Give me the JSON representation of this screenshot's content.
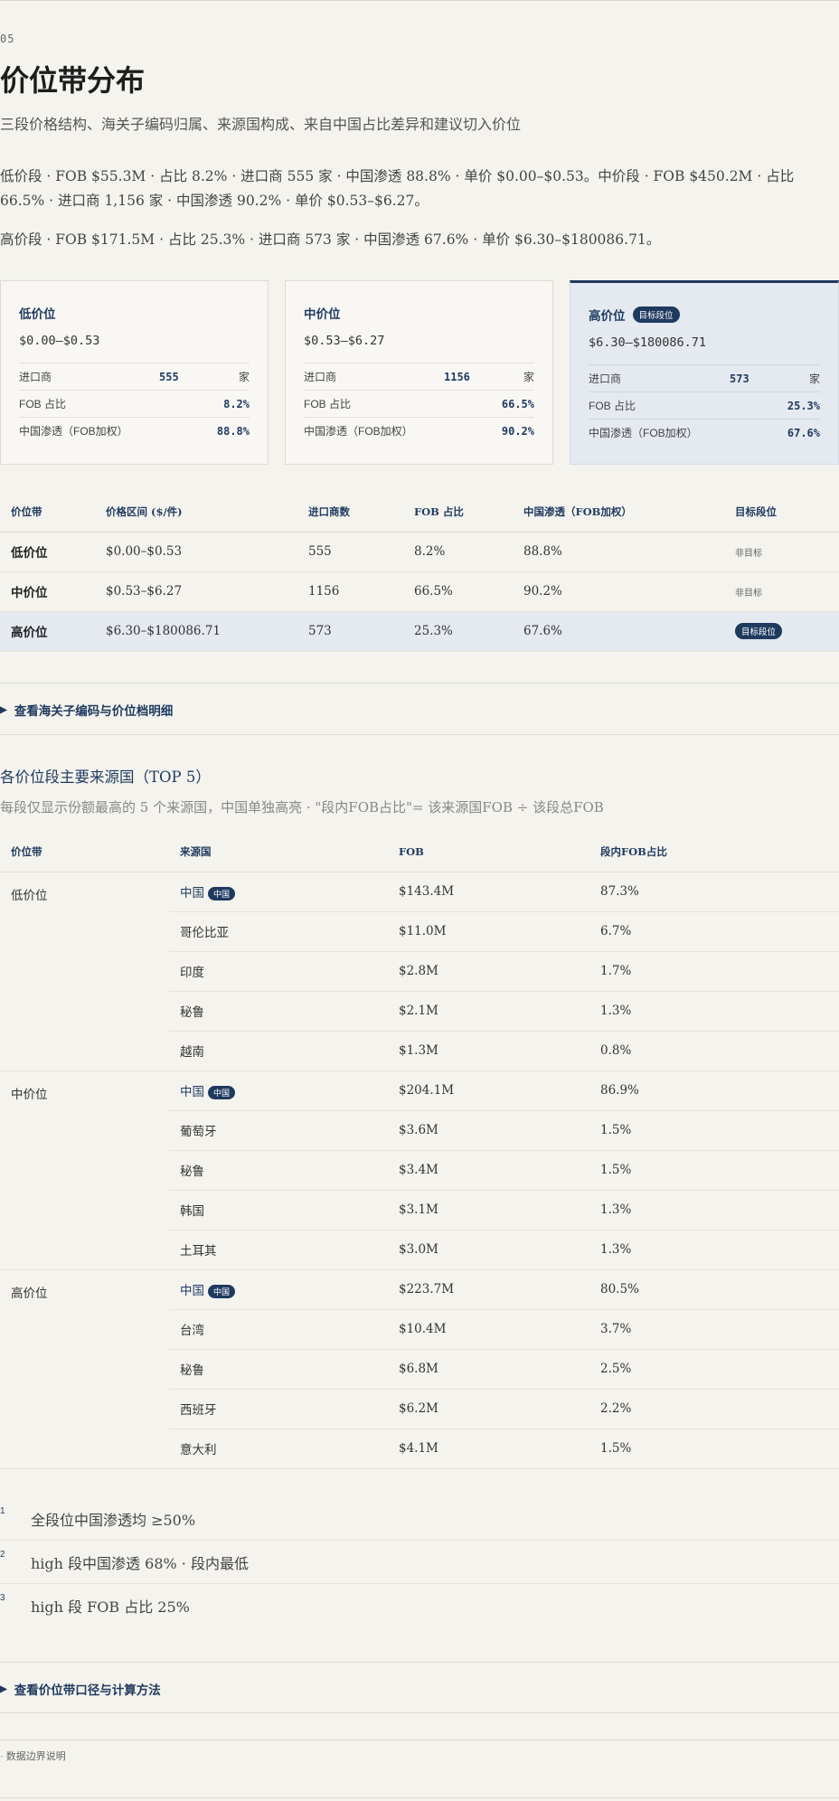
{
  "section_number": "05",
  "title": "价位带分布",
  "subtitle": "三段价格结构、海关子编码归属、来源国构成、来自中国占比差异和建议切入价位",
  "summary": {
    "line1": "低价段 · FOB $55.3M · 占比 8.2% · 进口商 555 家 · 中国渗透 88.8% · 单价 $0.00–$0.53。中价段 · FOB $450.2M · 占比 66.5% · 进口商 1,156 家 · 中国渗透 90.2% · 单价 $0.53–$6.27。",
    "line2": "高价段 · FOB $171.5M · 占比 25.3% · 进口商 573 家 · 中国渗透 67.6% · 单价 $6.30–$180086.71。"
  },
  "cards": [
    {
      "title": "低价位",
      "badge": "",
      "range": "$0.00–$0.53",
      "importers_label": "进口商",
      "importers": "555",
      "unit": "家",
      "fob_label": "FOB 占比",
      "fob": "8.2%",
      "cn_label": "中国渗透（FOB加权）",
      "cn": "88.8%"
    },
    {
      "title": "中价位",
      "badge": "",
      "range": "$0.53–$6.27",
      "importers_label": "进口商",
      "importers": "1156",
      "unit": "家",
      "fob_label": "FOB 占比",
      "fob": "66.5%",
      "cn_label": "中国渗透（FOB加权）",
      "cn": "90.2%"
    },
    {
      "title": "高价位",
      "badge": "目标段位",
      "range": "$6.30–$180086.71",
      "importers_label": "进口商",
      "importers": "573",
      "unit": "家",
      "fob_label": "FOB 占比",
      "fob": "25.3%",
      "cn_label": "中国渗透（FOB加权）",
      "cn": "67.6%"
    }
  ],
  "band_table": {
    "headers": [
      "价位带",
      "价格区间 ($/件)",
      "进口商数",
      "FOB 占比",
      "中国渗透（FOB加权）",
      "目标段位"
    ],
    "rows": [
      {
        "band": "低价位",
        "range": "$0.00–$0.53",
        "importers": "555",
        "fob": "8.2%",
        "cn": "88.8%",
        "target": "非目标"
      },
      {
        "band": "中价位",
        "range": "$0.53–$6.27",
        "importers": "1156",
        "fob": "66.5%",
        "cn": "90.2%",
        "target": "非目标"
      },
      {
        "band": "高价位",
        "range": "$6.30–$180086.71",
        "importers": "573",
        "fob": "25.3%",
        "cn": "67.6%",
        "target": "目标段位"
      }
    ]
  },
  "disclosure1": "查看海关子编码与价位档明细",
  "source_section": {
    "title": "各价位段主要来源国（TOP 5）",
    "subtitle": "每段仅显示份额最高的 5 个来源国，中国单独高亮 · \"段内FOB占比\"= 该来源国FOB ÷ 该段总FOB",
    "headers": [
      "价位带",
      "来源国",
      "FOB",
      "段内FOB占比"
    ],
    "china_badge": "中国",
    "groups": [
      {
        "band": "低价位",
        "rows": [
          {
            "country": "中国",
            "fob": "$143.4M",
            "share": "87.3%",
            "china": true
          },
          {
            "country": "哥伦比亚",
            "fob": "$11.0M",
            "share": "6.7%",
            "china": false
          },
          {
            "country": "印度",
            "fob": "$2.8M",
            "share": "1.7%",
            "china": false
          },
          {
            "country": "秘鲁",
            "fob": "$2.1M",
            "share": "1.3%",
            "china": false
          },
          {
            "country": "越南",
            "fob": "$1.3M",
            "share": "0.8%",
            "china": false
          }
        ]
      },
      {
        "band": "中价位",
        "rows": [
          {
            "country": "中国",
            "fob": "$204.1M",
            "share": "86.9%",
            "china": true
          },
          {
            "country": "葡萄牙",
            "fob": "$3.6M",
            "share": "1.5%",
            "china": false
          },
          {
            "country": "秘鲁",
            "fob": "$3.4M",
            "share": "1.5%",
            "china": false
          },
          {
            "country": "韩国",
            "fob": "$3.1M",
            "share": "1.3%",
            "china": false
          },
          {
            "country": "土耳其",
            "fob": "$3.0M",
            "share": "1.3%",
            "china": false
          }
        ]
      },
      {
        "band": "高价位",
        "rows": [
          {
            "country": "中国",
            "fob": "$223.7M",
            "share": "80.5%",
            "china": true
          },
          {
            "country": "台湾",
            "fob": "$10.4M",
            "share": "3.7%",
            "china": false
          },
          {
            "country": "秘鲁",
            "fob": "$6.8M",
            "share": "2.5%",
            "china": false
          },
          {
            "country": "西班牙",
            "fob": "$6.2M",
            "share": "2.2%",
            "china": false
          },
          {
            "country": "意大利",
            "fob": "$4.1M",
            "share": "1.5%",
            "china": false
          }
        ]
      }
    ]
  },
  "findings": [
    {
      "num": "1",
      "text": "全段位中国渗透均 ≥50%"
    },
    {
      "num": "2",
      "text": "high 段中国渗透 68% · 段内最低"
    },
    {
      "num": "3",
      "text": "high 段 FOB 占比 25%"
    }
  ],
  "disclosure2": "查看价位带口径与计算方法",
  "note": "· 数据边界说明",
  "colors": {
    "accent": "#1f3a5f",
    "highlight": "#e5e9f0",
    "background": "#f4f3ee"
  }
}
